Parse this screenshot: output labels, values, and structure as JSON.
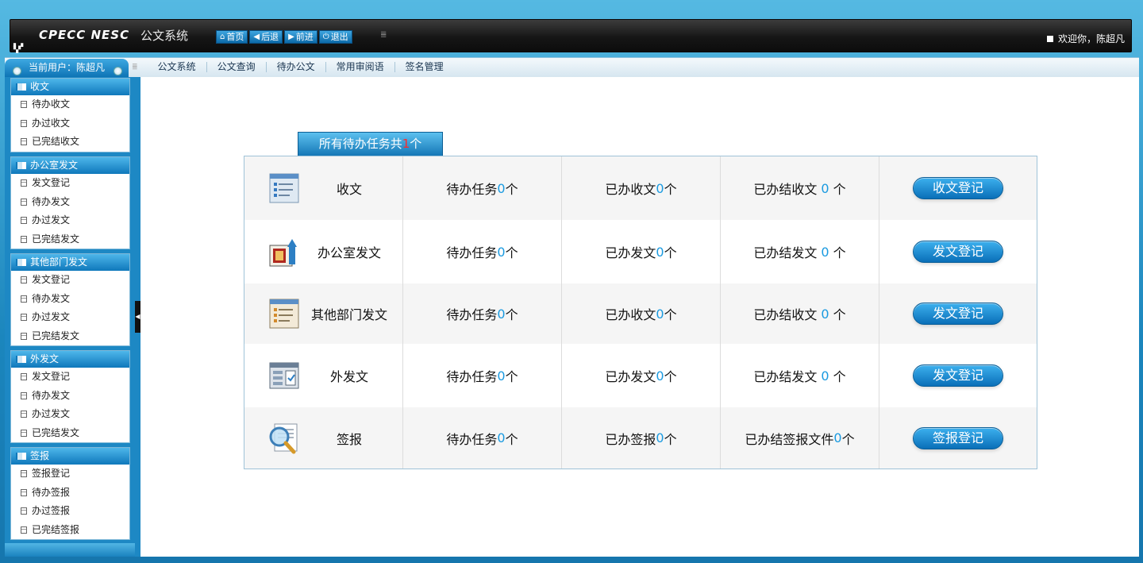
{
  "header": {
    "logo": "CPECC NESC",
    "app_title": "公文系统",
    "nav": [
      {
        "label": "首页",
        "icon": "home-icon"
      },
      {
        "label": "后退",
        "icon": "back-arrow-icon"
      },
      {
        "label": "前进",
        "icon": "forward-arrow-icon"
      },
      {
        "label": "退出",
        "icon": "power-icon"
      }
    ],
    "welcome": "欢迎你，陈超凡"
  },
  "menubar": {
    "current_user": "当前用户：陈超凡",
    "items": [
      "公文系统",
      "公文查询",
      "待办公文",
      "常用审阅语",
      "签名管理"
    ]
  },
  "sidebar": {
    "groups": [
      {
        "title": "收文",
        "items": [
          "待办收文",
          "办过收文",
          "已完结收文"
        ]
      },
      {
        "title": "办公室发文",
        "items": [
          "发文登记",
          "待办发文",
          "办过发文",
          "已完结发文"
        ]
      },
      {
        "title": "其他部门发文",
        "items": [
          "发文登记",
          "待办发文",
          "办过发文",
          "已完结发文"
        ]
      },
      {
        "title": "外发文",
        "items": [
          "发文登记",
          "待办发文",
          "办过发文",
          "已完结发文"
        ]
      },
      {
        "title": "签报",
        "items": [
          "签报登记",
          "待办签报",
          "办过签报",
          "已完结签报"
        ]
      }
    ]
  },
  "summary": {
    "prefix": "所有待办任务共",
    "count": "1",
    "suffix": "个"
  },
  "rows": [
    {
      "category": "收文",
      "icon": "inbox-document-icon",
      "c1_label": "待办任务",
      "c1_num": "0",
      "c1_suffix": "个",
      "c2_label": "已办收文",
      "c2_num": "0",
      "c2_suffix": "个",
      "c3_label": "已办结收文 ",
      "c3_num": "0",
      "c3_suffix": " 个",
      "button": "收文登记"
    },
    {
      "category": "办公室发文",
      "icon": "office-send-icon",
      "c1_label": "待办任务",
      "c1_num": "0",
      "c1_suffix": "个",
      "c2_label": "已办发文",
      "c2_num": "0",
      "c2_suffix": "个",
      "c3_label": "已办结发文 ",
      "c3_num": "0",
      "c3_suffix": " 个",
      "button": "发文登记"
    },
    {
      "category": "其他部门发文",
      "icon": "department-document-icon",
      "c1_label": "待办任务",
      "c1_num": "0",
      "c1_suffix": "个",
      "c2_label": "已办收文",
      "c2_num": "0",
      "c2_suffix": "个",
      "c3_label": "已办结收文 ",
      "c3_num": "0",
      "c3_suffix": " 个",
      "button": "发文登记"
    },
    {
      "category": "外发文",
      "icon": "outgoing-document-icon",
      "c1_label": "待办任务",
      "c1_num": "0",
      "c1_suffix": "个",
      "c2_label": "已办发文",
      "c2_num": "0",
      "c2_suffix": "个",
      "c3_label": "已办结发文 ",
      "c3_num": "0",
      "c3_suffix": " 个",
      "button": "发文登记"
    },
    {
      "category": "签报",
      "icon": "magnifier-document-icon",
      "c1_label": "待办任务",
      "c1_num": "0",
      "c1_suffix": "个",
      "c2_label": "已办签报",
      "c2_num": "0",
      "c2_suffix": "个",
      "c3_label": "已办结签报文件",
      "c3_num": "0",
      "c3_suffix": "个",
      "button": "签报登记"
    }
  ],
  "colors": {
    "accent": "#1a9ae0",
    "highlight": "#ff2a2a",
    "frame": "#1d88c4"
  }
}
